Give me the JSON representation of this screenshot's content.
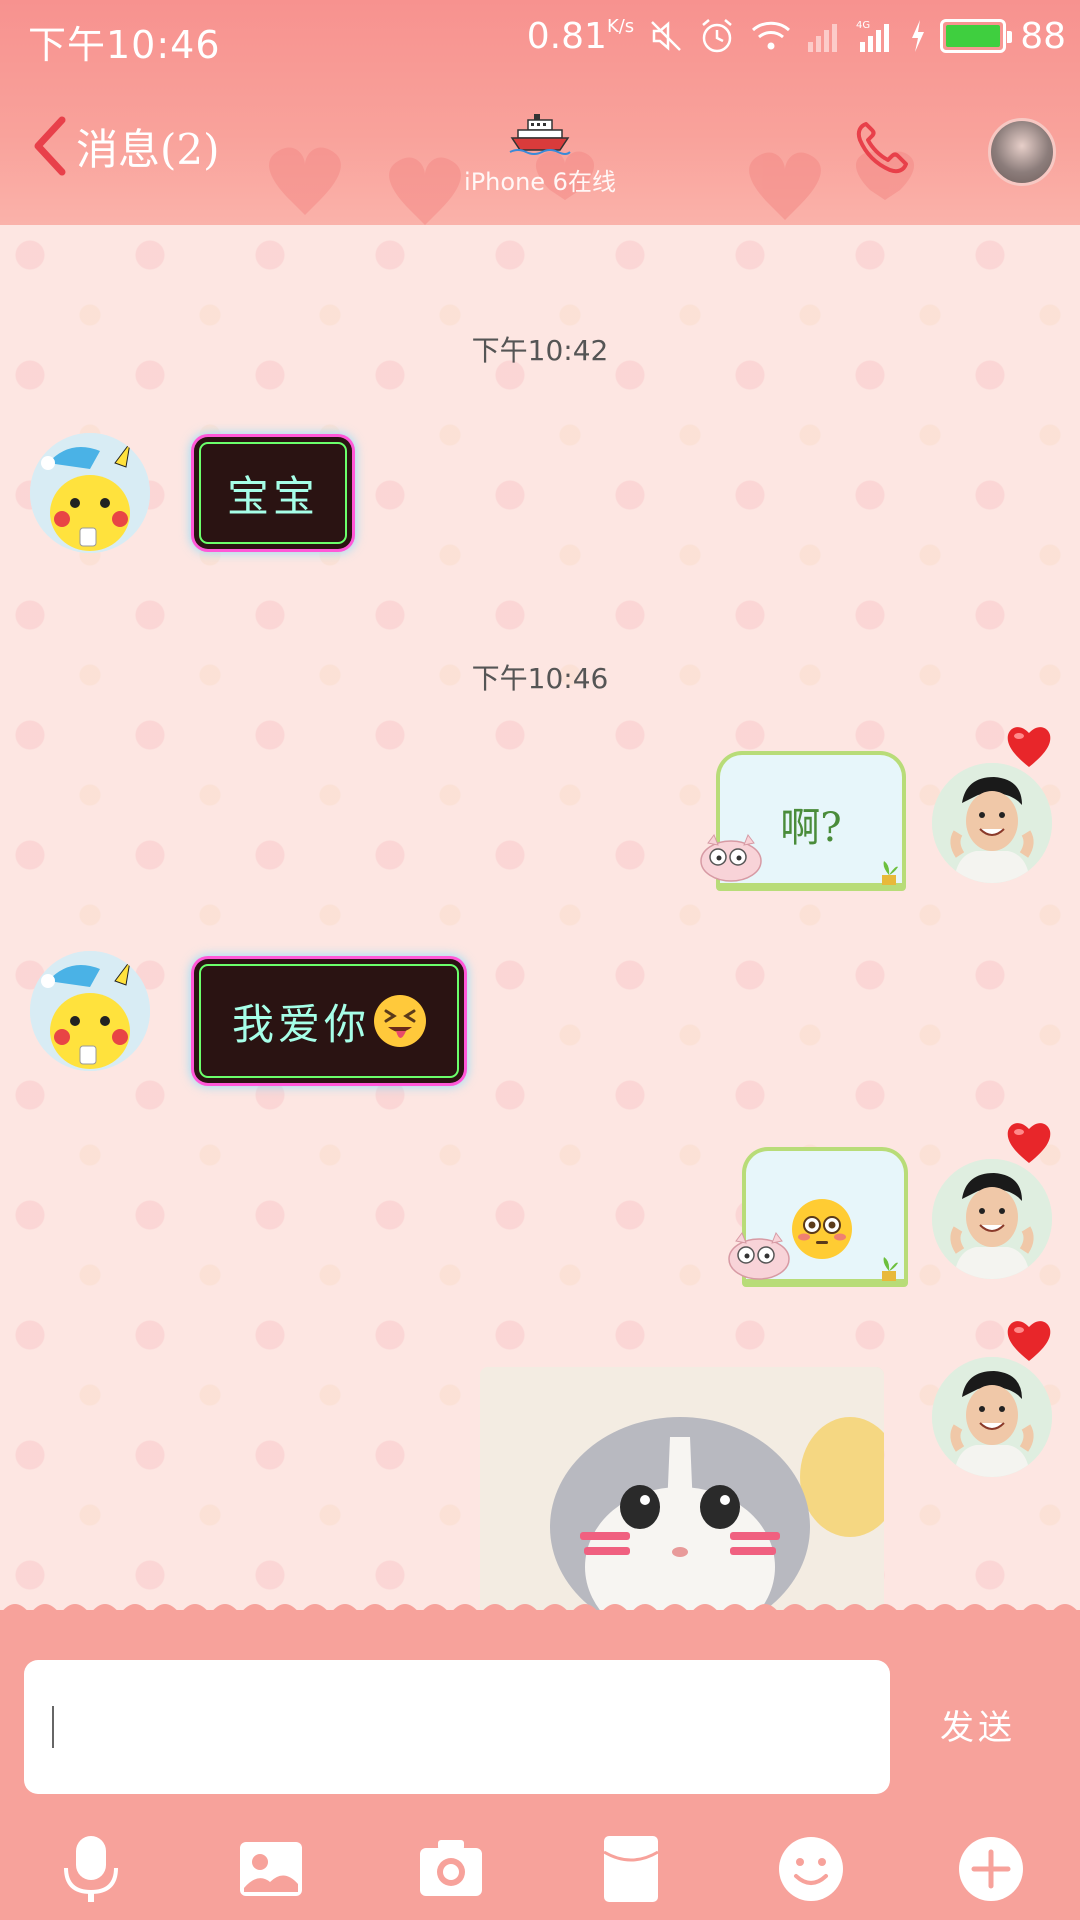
{
  "status_bar": {
    "time": "下午10:46",
    "net_speed": "0.81",
    "net_speed_unit": "K/s",
    "battery": "88",
    "battery_color": "#3fcf3f"
  },
  "header": {
    "back_label": "消息(2)",
    "title_icon": "ship-icon",
    "subtitle": "iPhone 6在线",
    "call_icon": "phone-icon"
  },
  "messages": {
    "ts1": "下午10:42",
    "m1_text": "宝宝",
    "ts2": "下午10:46",
    "m2_text": "啊?",
    "m3_text": "我爱你",
    "m3_emoji": "squinting-tongue-emoji",
    "m4_emoji": "flushed-face-emoji",
    "m5_image": "kitten-photo"
  },
  "composer": {
    "input_value": "",
    "send_label": "发送"
  },
  "toolbar": {
    "items": [
      "microphone-icon",
      "image-icon",
      "camera-icon",
      "red-packet-icon",
      "emoji-icon",
      "plus-icon"
    ]
  },
  "colors": {
    "theme_pink": "#f7a29b",
    "neon_text": "#a6ffe8",
    "note_border": "#b8dc78"
  }
}
